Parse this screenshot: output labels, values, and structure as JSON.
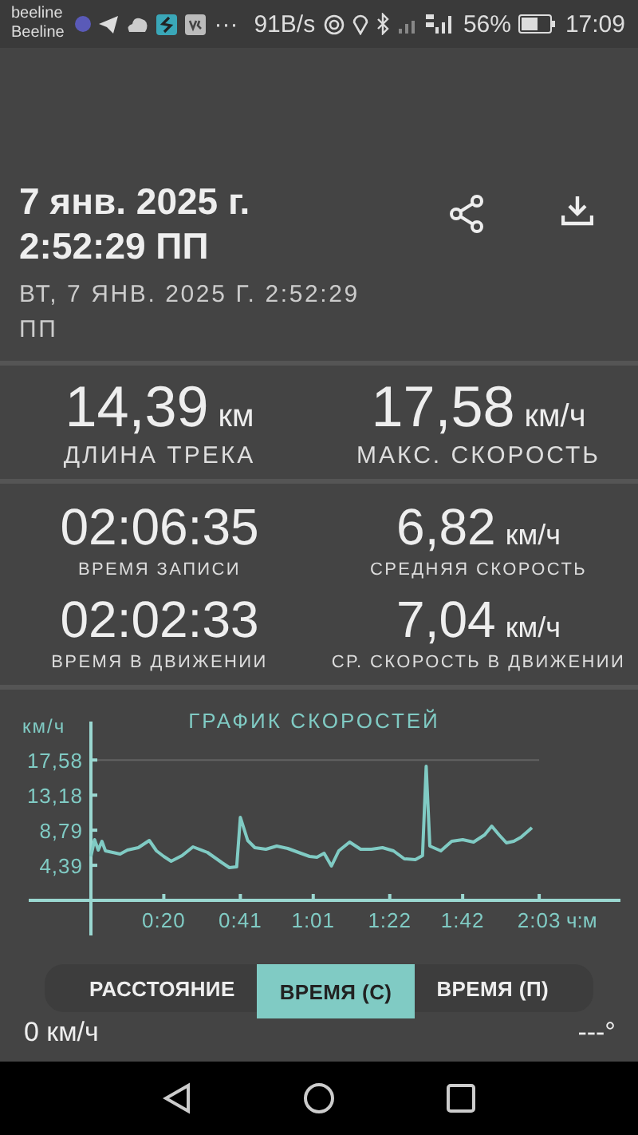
{
  "status_bar": {
    "carrier_top": "beeline",
    "carrier_bottom": "Beeline",
    "more": "···",
    "speed": "91B/s",
    "battery": "56%",
    "time": "17:09"
  },
  "track": {
    "title_date": "7 янв. 2025 г.",
    "title_time": "2:52:29 ПП",
    "subtitle": "ВТ, 7 ЯНВ. 2025 Г. 2:52:29 ПП"
  },
  "stats_primary": [
    {
      "value": "14,39",
      "unit": "км",
      "label": "ДЛИНА ТРЕКА"
    },
    {
      "value": "17,58",
      "unit": "км/ч",
      "label": "МАКС. СКОРОСТЬ"
    }
  ],
  "stats_secondary": [
    {
      "value": "02:06:35",
      "label": "ВРЕМЯ ЗАПИСИ"
    },
    {
      "value": "6,82",
      "unit": "км/ч",
      "label": "СРЕДНЯЯ СКОРОСТЬ"
    },
    {
      "value": "02:02:33",
      "label": "ВРЕМЯ В ДВИЖЕНИИ"
    },
    {
      "value": "7,04",
      "unit": "км/ч",
      "label": "СР. СКОРОСТЬ В ДВИЖЕНИИ"
    }
  ],
  "speed_chart": {
    "chart_data": {
      "type": "line",
      "title": "ГРАФИК СКОРОСТЕЙ",
      "xlabel": "ч:м",
      "ylabel": "км/ч",
      "x": [
        0,
        1,
        2,
        3,
        4,
        6,
        8,
        10,
        13,
        16,
        18,
        20,
        22,
        25,
        28,
        32,
        36,
        38,
        40,
        41,
        43,
        45,
        48,
        51,
        54,
        57,
        60,
        62,
        64,
        66,
        68,
        71,
        74,
        77,
        80,
        83,
        86,
        89,
        91,
        92,
        93,
        96,
        99,
        102,
        105,
        108,
        110,
        112,
        114,
        116,
        118,
        121
      ],
      "series": [
        {
          "color": "#80cbc4",
          "values": [
            5.5,
            7.6,
            6.3,
            7.4,
            6.2,
            6.0,
            5.8,
            6.3,
            6.6,
            7.5,
            6.2,
            5.5,
            4.9,
            5.6,
            6.7,
            6.0,
            4.7,
            4.1,
            4.2,
            10.4,
            7.5,
            6.6,
            6.4,
            6.8,
            6.5,
            6.0,
            5.5,
            5.4,
            5.9,
            4.3,
            6.2,
            7.3,
            6.4,
            6.4,
            6.6,
            6.2,
            5.2,
            5.1,
            5.6,
            16.8,
            6.8,
            6.2,
            7.4,
            7.6,
            7.3,
            8.2,
            9.3,
            8.2,
            7.2,
            7.4,
            7.9,
            9.1
          ]
        }
      ],
      "xlim": [
        -17.07,
        145.3
      ],
      "ylim": [
        -4.4,
        22.4
      ],
      "xticks": [
        {
          "value": 20,
          "label": "0:20"
        },
        {
          "value": 41,
          "label": "0:41"
        },
        {
          "value": 61,
          "label": "1:01"
        },
        {
          "value": 82,
          "label": "1:22"
        },
        {
          "value": 102,
          "label": "1:42"
        },
        {
          "value": 123,
          "label": "2:03"
        }
      ],
      "yticks": [
        {
          "value": 4.39,
          "label": "4,39"
        },
        {
          "value": 8.79,
          "label": "8,79"
        },
        {
          "value": 13.18,
          "label": "13,18"
        },
        {
          "value": 17.58,
          "label": "17,58"
        }
      ]
    }
  },
  "mode_tabs": [
    {
      "label": "РАССТОЯНИЕ",
      "selected": false
    },
    {
      "label": "ВРЕМЯ (С)",
      "selected": true
    },
    {
      "label": "ВРЕМЯ (П)",
      "selected": false
    }
  ],
  "footer": {
    "current_speed": "0 км/ч",
    "heading": "---°"
  }
}
